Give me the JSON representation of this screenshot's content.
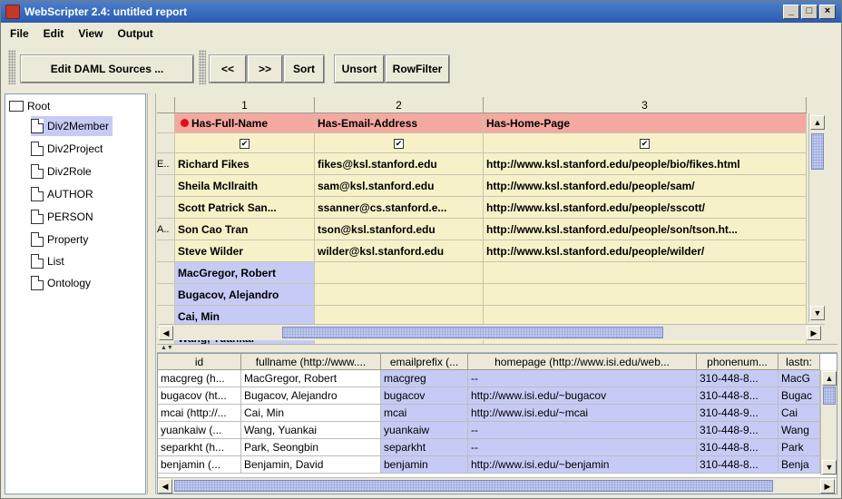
{
  "window": {
    "title": "WebScripter 2.4: untitled report",
    "min": "_",
    "max": "□",
    "close": "×"
  },
  "menu": [
    "File",
    "Edit",
    "View",
    "Output"
  ],
  "toolbar": {
    "edit_daml": "Edit DAML Sources ...",
    "prev": "<<",
    "next": ">>",
    "sort": "Sort",
    "unsort": "Unsort",
    "rowfilter": "RowFilter"
  },
  "tree": {
    "root": "Root",
    "items": [
      "Div2Member",
      "Div2Project",
      "Div2Role",
      "AUTHOR",
      "PERSON",
      "Property",
      "List",
      "Ontology"
    ],
    "selected": "Div2Member"
  },
  "report": {
    "col_numbers": [
      "1",
      "2",
      "3"
    ],
    "headers": [
      "Has-Full-Name",
      "Has-Email-Address",
      "Has-Home-Page"
    ],
    "row_prefix": [
      "E..",
      "",
      "",
      "A..",
      ""
    ],
    "rows": [
      [
        "Richard Fikes",
        "fikes@ksl.stanford.edu",
        "http://www.ksl.stanford.edu/people/bio/fikes.html"
      ],
      [
        "Sheila McIlraith",
        "sam@ksl.stanford.edu",
        "http://www.ksl.stanford.edu/people/sam/"
      ],
      [
        "Scott Patrick San...",
        "ssanner@cs.stanford.e...",
        "http://www.ksl.stanford.edu/people/sscott/"
      ],
      [
        "Son Cao Tran",
        "tson@ksl.stanford.edu",
        "http://www.ksl.stanford.edu/people/son/tson.ht..."
      ],
      [
        "Steve Wilder",
        "wilder@ksl.stanford.edu",
        "http://www.ksl.stanford.edu/people/wilder/"
      ],
      [
        "MacGregor, Robert",
        "",
        ""
      ],
      [
        "Bugacov, Alejandro",
        "",
        ""
      ],
      [
        "Cai, Min",
        "",
        ""
      ],
      [
        "Wang, Yuankai",
        "",
        ""
      ]
    ]
  },
  "source": {
    "headers": [
      "id",
      "fullname (http://www....",
      "emailprefix (...",
      "homepage (http://www.isi.edu/web...",
      "phonenum...",
      "lastn:"
    ],
    "rows": [
      [
        "macgreg (h...",
        "MacGregor, Robert",
        "macgreg",
        "--",
        "310-448-8...",
        "MacG"
      ],
      [
        "bugacov (ht...",
        "Bugacov, Alejandro",
        "bugacov",
        "http://www.isi.edu/~bugacov",
        "310-448-8...",
        "Bugac"
      ],
      [
        "mcai (http://...",
        "Cai, Min",
        "mcai",
        "http://www.isi.edu/~mcai",
        "310-448-9...",
        "Cai"
      ],
      [
        "yuankaiw (...",
        "Wang, Yuankai",
        "yuankaiw",
        "--",
        "310-448-9...",
        "Wang"
      ],
      [
        "separkht (h...",
        "Park, Seongbin",
        "separkht",
        "--",
        "310-448-8...",
        "Park"
      ],
      [
        "benjamin (...",
        "Benjamin, David",
        "benjamin",
        "http://www.isi.edu/~benjamin",
        "310-448-8...",
        "Benja"
      ]
    ]
  },
  "colors": {
    "header_pink": "#f4a8a0",
    "row_tan": "#f6f1c8",
    "selection_lavender": "#c6cbf6",
    "title_blue": "#2a5bb1"
  }
}
